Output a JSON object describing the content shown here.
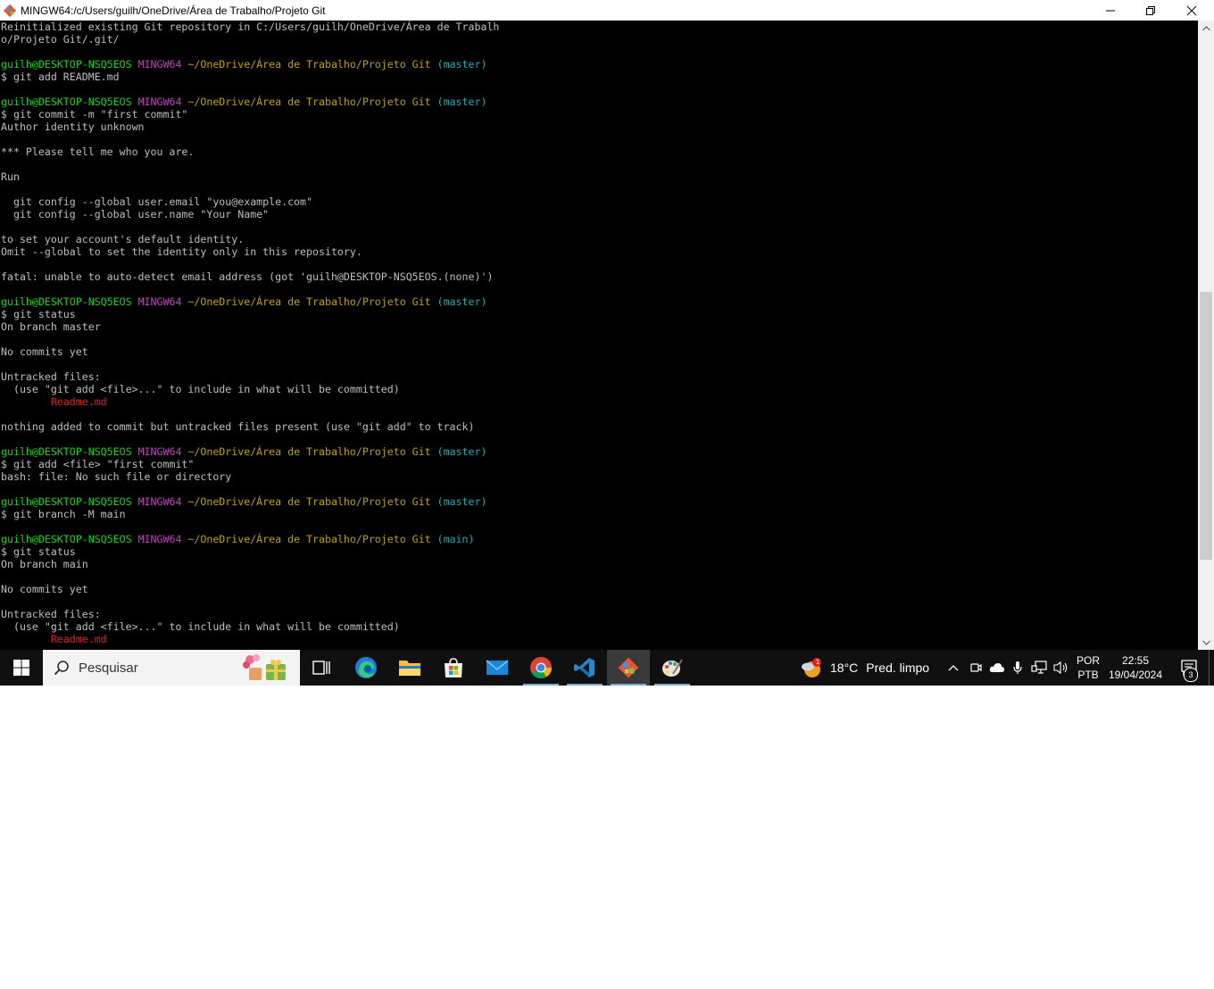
{
  "window": {
    "title": "MINGW64:/c/Users/guilh/OneDrive/Área de Trabalho/Projeto Git"
  },
  "terminal": {
    "lines": [
      {
        "segments": [
          {
            "text": "Reinitialized existing Git repository in C:/Users/guilh/OneDrive/Área de Trabalh",
            "color": "default"
          }
        ]
      },
      {
        "segments": [
          {
            "text": "o/Projeto Git/.git/",
            "color": "default"
          }
        ]
      },
      {
        "segments": []
      },
      {
        "segments": [
          {
            "text": "guilh@DESKTOP-NSQ5EOS ",
            "color": "green"
          },
          {
            "text": "MINGW64 ",
            "color": "magenta"
          },
          {
            "text": "~/OneDrive/Área de Trabalho/Projeto Git ",
            "color": "yellow"
          },
          {
            "text": "(master)",
            "color": "cyan"
          }
        ]
      },
      {
        "segments": [
          {
            "text": "$ git add README.md",
            "color": "default"
          }
        ]
      },
      {
        "segments": []
      },
      {
        "segments": [
          {
            "text": "guilh@DESKTOP-NSQ5EOS ",
            "color": "green"
          },
          {
            "text": "MINGW64 ",
            "color": "magenta"
          },
          {
            "text": "~/OneDrive/Área de Trabalho/Projeto Git ",
            "color": "yellow"
          },
          {
            "text": "(master)",
            "color": "cyan"
          }
        ]
      },
      {
        "segments": [
          {
            "text": "$ git commit -m \"first commit\"",
            "color": "default"
          }
        ]
      },
      {
        "segments": [
          {
            "text": "Author identity unknown",
            "color": "default"
          }
        ]
      },
      {
        "segments": []
      },
      {
        "segments": [
          {
            "text": "*** Please tell me who you are.",
            "color": "default"
          }
        ]
      },
      {
        "segments": []
      },
      {
        "segments": [
          {
            "text": "Run",
            "color": "default"
          }
        ]
      },
      {
        "segments": []
      },
      {
        "segments": [
          {
            "text": "  git config --global user.email \"you@example.com\"",
            "color": "default"
          }
        ]
      },
      {
        "segments": [
          {
            "text": "  git config --global user.name \"Your Name\"",
            "color": "default"
          }
        ]
      },
      {
        "segments": []
      },
      {
        "segments": [
          {
            "text": "to set your account's default identity.",
            "color": "default"
          }
        ]
      },
      {
        "segments": [
          {
            "text": "Omit --global to set the identity only in this repository.",
            "color": "default"
          }
        ]
      },
      {
        "segments": []
      },
      {
        "segments": [
          {
            "text": "fatal: unable to auto-detect email address (got 'guilh@DESKTOP-NSQ5EOS.(none)')",
            "color": "default"
          }
        ]
      },
      {
        "segments": []
      },
      {
        "segments": [
          {
            "text": "guilh@DESKTOP-NSQ5EOS ",
            "color": "green"
          },
          {
            "text": "MINGW64 ",
            "color": "magenta"
          },
          {
            "text": "~/OneDrive/Área de Trabalho/Projeto Git ",
            "color": "yellow"
          },
          {
            "text": "(master)",
            "color": "cyan"
          }
        ]
      },
      {
        "segments": [
          {
            "text": "$ git status",
            "color": "default"
          }
        ]
      },
      {
        "segments": [
          {
            "text": "On branch master",
            "color": "default"
          }
        ]
      },
      {
        "segments": []
      },
      {
        "segments": [
          {
            "text": "No commits yet",
            "color": "default"
          }
        ]
      },
      {
        "segments": []
      },
      {
        "segments": [
          {
            "text": "Untracked files:",
            "color": "default"
          }
        ]
      },
      {
        "segments": [
          {
            "text": "  (use \"git add <file>...\" to include in what will be committed)",
            "color": "default"
          }
        ]
      },
      {
        "segments": [
          {
            "text": "        ",
            "color": "default"
          },
          {
            "text": "Readme.md",
            "color": "red"
          }
        ]
      },
      {
        "segments": []
      },
      {
        "segments": [
          {
            "text": "nothing added to commit but untracked files present (use \"git add\" to track)",
            "color": "default"
          }
        ]
      },
      {
        "segments": []
      },
      {
        "segments": [
          {
            "text": "guilh@DESKTOP-NSQ5EOS ",
            "color": "green"
          },
          {
            "text": "MINGW64 ",
            "color": "magenta"
          },
          {
            "text": "~/OneDrive/Área de Trabalho/Projeto Git ",
            "color": "yellow"
          },
          {
            "text": "(master)",
            "color": "cyan"
          }
        ]
      },
      {
        "segments": [
          {
            "text": "$ git add <file> \"first commit\"",
            "color": "default"
          }
        ]
      },
      {
        "segments": [
          {
            "text": "bash: file: No such file or directory",
            "color": "default"
          }
        ]
      },
      {
        "segments": []
      },
      {
        "segments": [
          {
            "text": "guilh@DESKTOP-NSQ5EOS ",
            "color": "green"
          },
          {
            "text": "MINGW64 ",
            "color": "magenta"
          },
          {
            "text": "~/OneDrive/Área de Trabalho/Projeto Git ",
            "color": "yellow"
          },
          {
            "text": "(master)",
            "color": "cyan"
          }
        ]
      },
      {
        "segments": [
          {
            "text": "$ git branch -M main",
            "color": "default"
          }
        ]
      },
      {
        "segments": []
      },
      {
        "segments": [
          {
            "text": "guilh@DESKTOP-NSQ5EOS ",
            "color": "green"
          },
          {
            "text": "MINGW64 ",
            "color": "magenta"
          },
          {
            "text": "~/OneDrive/Área de Trabalho/Projeto Git ",
            "color": "yellow"
          },
          {
            "text": "(main)",
            "color": "cyan"
          }
        ]
      },
      {
        "segments": [
          {
            "text": "$ git status",
            "color": "default"
          }
        ]
      },
      {
        "segments": [
          {
            "text": "On branch main",
            "color": "default"
          }
        ]
      },
      {
        "segments": []
      },
      {
        "segments": [
          {
            "text": "No commits yet",
            "color": "default"
          }
        ]
      },
      {
        "segments": []
      },
      {
        "segments": [
          {
            "text": "Untracked files:",
            "color": "default"
          }
        ]
      },
      {
        "segments": [
          {
            "text": "  (use \"git add <file>...\" to include in what will be committed)",
            "color": "default"
          }
        ]
      },
      {
        "segments": [
          {
            "text": "        ",
            "color": "default"
          },
          {
            "text": "Readme.md",
            "color": "red"
          }
        ]
      }
    ]
  },
  "taskbar": {
    "search_placeholder": "Pesquisar",
    "apps": [
      {
        "name": "task-view-icon"
      },
      {
        "name": "edge-icon"
      },
      {
        "name": "file-explorer-icon"
      },
      {
        "name": "microsoft-store-icon"
      },
      {
        "name": "mail-icon"
      },
      {
        "name": "chrome-icon"
      },
      {
        "name": "vscode-icon"
      },
      {
        "name": "git-bash-icon"
      },
      {
        "name": "paint-icon"
      }
    ],
    "weather": {
      "badge": "1",
      "temp": "18°C",
      "condition": "Pred. limpo"
    },
    "language": {
      "line1": "POR",
      "line2": "PTB"
    },
    "clock": {
      "time": "22:55",
      "date": "19/04/2024"
    },
    "notification_count": "3"
  },
  "colors": {
    "terminal_bg": "#000000",
    "terminal_text": "#bfbfbf",
    "prompt_user": "#1cd01c",
    "prompt_mingw": "#c040c0",
    "prompt_path": "#c0a000",
    "prompt_branch": "#20a8b0",
    "untracked_file": "#e02020",
    "taskbar_bg": "#101010"
  }
}
